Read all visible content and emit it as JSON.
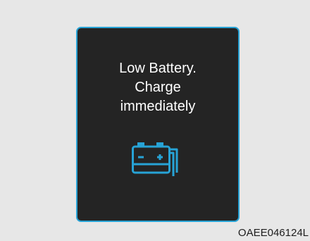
{
  "display": {
    "message_lines": [
      "Low Battery.",
      "Charge",
      "immediately"
    ],
    "icon": "battery-warning-icon",
    "accent_color": "#27a3d6",
    "background_color": "#242424",
    "text_color": "#ffffff"
  },
  "figure": {
    "code": "OAEE046124L"
  }
}
